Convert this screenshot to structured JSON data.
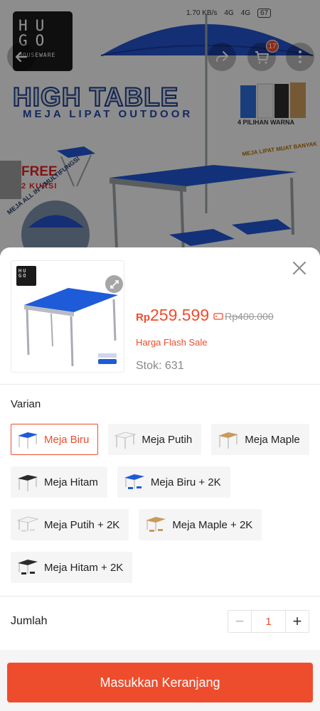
{
  "status_bar": {
    "wifi": "1.70 KB/s",
    "signal1": "4G",
    "signal2": "4G",
    "battery": "67"
  },
  "banner": {
    "brand_big": "HU GO",
    "brand_small": "HOUSEWARE",
    "title": "HIGH TABLE",
    "subtitle": "MEJA LIPAT OUTDOOR",
    "free": "FREE",
    "free_sub": "2 KURSI",
    "colors_note": "4 PILIHAN WARNA",
    "allin1": "MEJA ALL IN 1 MULTIFUNGSI",
    "side_note": "MEJA LIPAT MUAT BANYAK"
  },
  "nav": {
    "cart_count": "17"
  },
  "product": {
    "price_currency": "Rp",
    "price": "259.599",
    "original_price": "Rp400.000",
    "flash_label": "Harga Flash Sale",
    "stock": "Stok: 631",
    "thumb_logo": "HU GO"
  },
  "variants_title": "Varian",
  "variants": [
    {
      "label": "Meja Biru",
      "color": "#1d5bd8",
      "selected": true
    },
    {
      "label": "Meja Putih",
      "color": "#e8e8e8"
    },
    {
      "label": "Meja Maple",
      "color": "#c99a5b"
    },
    {
      "label": "Meja Hitam",
      "color": "#2b2b2b"
    },
    {
      "label": "Meja Biru + 2K",
      "color": "#1d5bd8"
    },
    {
      "label": "Meja Putih + 2K",
      "color": "#e8e8e8"
    },
    {
      "label": "Meja Maple + 2K",
      "color": "#c99a5b"
    },
    {
      "label": "Meja Hitam + 2K",
      "color": "#2b2b2b"
    }
  ],
  "quantity": {
    "label": "Jumlah",
    "value": "1",
    "minus": "−",
    "plus": "+"
  },
  "cta": {
    "label": "Masukkan Keranjang"
  },
  "colors": {
    "accent": "#ee4d2d",
    "table_blue": "#1d5bd8"
  }
}
